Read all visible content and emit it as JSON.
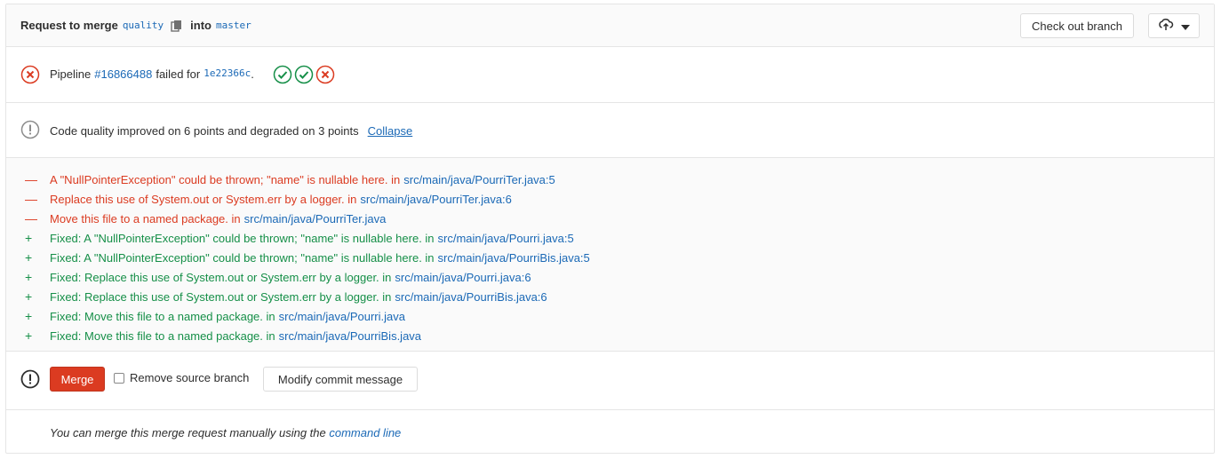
{
  "header": {
    "title_prefix": "Request to merge",
    "source_branch": "quality",
    "into_word": "into",
    "target_branch": "master",
    "checkout_label": "Check out branch",
    "icons": {
      "copy": "clipboard-icon",
      "download": "cloud-download-icon",
      "caret": "caret-down-icon"
    }
  },
  "pipeline": {
    "prefix": "Pipeline",
    "id": "#16866488",
    "status_text": "failed for",
    "commit": "1e22366c",
    "commit_suffix": ".",
    "stages": [
      "success",
      "success",
      "failed"
    ],
    "colors": {
      "failed": "#db3b21",
      "success": "#168f48"
    }
  },
  "quality": {
    "summary": "Code quality improved on 6 points and degraded on 3 points",
    "collapse_label": "Collapse"
  },
  "issues": [
    {
      "type": "degraded",
      "sign": "—",
      "text": "A \"NullPointerException\" could be thrown; \"name\" is nullable here. in",
      "location": "src/main/java/PourriTer.java:5"
    },
    {
      "type": "degraded",
      "sign": "—",
      "text": "Replace this use of System.out or System.err by a logger. in",
      "location": "src/main/java/PourriTer.java:6"
    },
    {
      "type": "degraded",
      "sign": "—",
      "text": "Move this file to a named package. in",
      "location": "src/main/java/PourriTer.java"
    },
    {
      "type": "fixed",
      "sign": "+",
      "text": "Fixed: A \"NullPointerException\" could be thrown; \"name\" is nullable here. in",
      "location": "src/main/java/Pourri.java:5"
    },
    {
      "type": "fixed",
      "sign": "+",
      "text": "Fixed: A \"NullPointerException\" could be thrown; \"name\" is nullable here. in",
      "location": "src/main/java/PourriBis.java:5"
    },
    {
      "type": "fixed",
      "sign": "+",
      "text": "Fixed: Replace this use of System.out or System.err by a logger. in",
      "location": "src/main/java/Pourri.java:6"
    },
    {
      "type": "fixed",
      "sign": "+",
      "text": "Fixed: Replace this use of System.out or System.err by a logger. in",
      "location": "src/main/java/PourriBis.java:6"
    },
    {
      "type": "fixed",
      "sign": "+",
      "text": "Fixed: Move this file to a named package. in",
      "location": "src/main/java/Pourri.java"
    },
    {
      "type": "fixed",
      "sign": "+",
      "text": "Fixed: Move this file to a named package. in",
      "location": "src/main/java/PourriBis.java"
    }
  ],
  "merge": {
    "merge_label": "Merge",
    "remove_source_label": "Remove source branch",
    "modify_commit_label": "Modify commit message"
  },
  "footer": {
    "text": "You can merge this merge request manually using the",
    "link": "command line"
  }
}
